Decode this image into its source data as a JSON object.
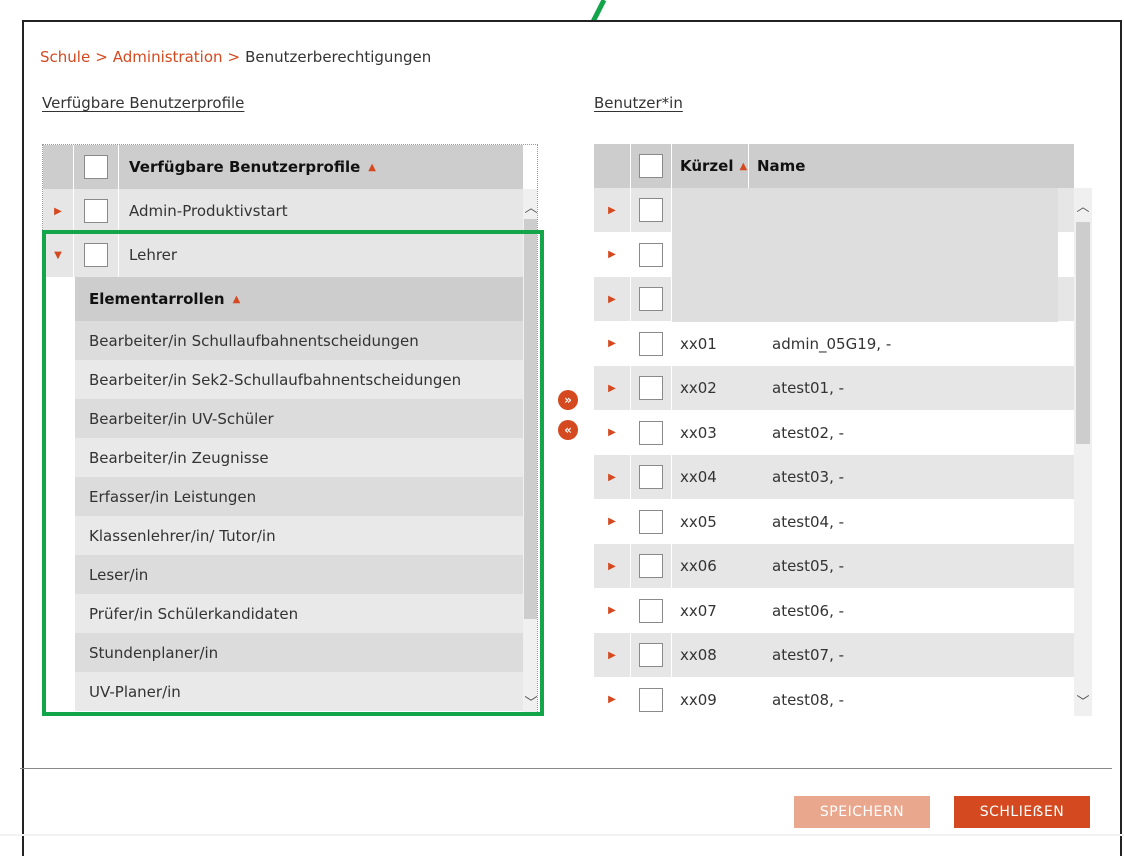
{
  "breadcrumb": {
    "school": "Schule",
    "admin": "Administration",
    "current": "Benutzerberechtigungen",
    "separator": ">"
  },
  "left_panel": {
    "title": "Verfügbare Benutzerprofile",
    "header": "Verfügbare Benutzerprofile",
    "profiles": [
      {
        "label": "Admin-Produktivstart",
        "expanded": false
      },
      {
        "label": "Lehrer",
        "expanded": true
      }
    ],
    "sub_header": "Elementarrollen",
    "roles": [
      "Bearbeiter/in Schullaufbahnentscheidungen",
      "Bearbeiter/in Sek2-Schullaufbahnentscheidungen",
      "Bearbeiter/in UV-Schüler",
      "Bearbeiter/in Zeugnisse",
      "Erfasser/in Leistungen",
      "Klassenlehrer/in/ Tutor/in",
      "Leser/in",
      "Prüfer/in Schülerkandidaten",
      "Stundenplaner/in",
      "UV-Planer/in"
    ]
  },
  "right_panel": {
    "title": "Benutzer*in",
    "col_kuerzel": "Kürzel",
    "col_name": "Name",
    "users": [
      {
        "kuerzel": "",
        "name": ""
      },
      {
        "kuerzel": "",
        "name": ""
      },
      {
        "kuerzel": "",
        "name": ""
      },
      {
        "kuerzel": "xx01",
        "name": "admin_05G19, -"
      },
      {
        "kuerzel": "xx02",
        "name": "atest01, -"
      },
      {
        "kuerzel": "xx03",
        "name": "atest02, -"
      },
      {
        "kuerzel": "xx04",
        "name": "atest03, -"
      },
      {
        "kuerzel": "xx05",
        "name": "atest04, -"
      },
      {
        "kuerzel": "xx06",
        "name": "atest05, -"
      },
      {
        "kuerzel": "xx07",
        "name": "atest06, -"
      },
      {
        "kuerzel": "xx08",
        "name": "atest07, -"
      },
      {
        "kuerzel": "xx09",
        "name": "atest08, -"
      }
    ]
  },
  "move_buttons": {
    "add": "»",
    "remove": "«"
  },
  "buttons": {
    "save": "SPEICHERN",
    "close": "SCHLIEẞEN"
  },
  "icons": {
    "expand": "triangle-right-icon",
    "collapse": "triangle-down-icon",
    "sort": "sort-up-icon",
    "scroll_up": "chevron-up-icon",
    "scroll_down": "chevron-down-icon"
  },
  "colors": {
    "accent": "#d4491f",
    "annotation": "#13a54a",
    "header_bg": "#cdcdcd",
    "row_bg": "#e6e6e6"
  }
}
